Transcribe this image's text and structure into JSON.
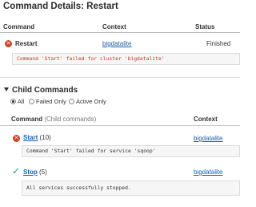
{
  "page": {
    "title": "Command Details: Restart"
  },
  "table": {
    "headers": {
      "command": "Command",
      "context": "Context",
      "status": "Status"
    },
    "row": {
      "name": "Restart",
      "context": "bigdatalite",
      "status": "Finished",
      "message": "Command 'Start' failed for cluster 'bigdatalite'"
    }
  },
  "child_commands": {
    "title": "Child Commands",
    "filters": [
      "All",
      "Failed Only",
      "Active Only"
    ],
    "selected_filter": "All",
    "headers": {
      "command": "Command",
      "command_note": "(Child commands)",
      "context": "Context"
    },
    "items": [
      {
        "name": "Start",
        "count": "(10)",
        "context": "bigdatalite",
        "message": "Command 'Start' failed for service 'sqoop'",
        "status_icon": "error-icon"
      },
      {
        "name": "Stop",
        "count": "(5)",
        "context": "bigdatalite",
        "message": "All services successfully stopped.",
        "status_icon": "check-icon"
      }
    ]
  },
  "colors": {
    "error": "#c9462b",
    "success": "#2aa198",
    "link": "#1a5fa8"
  }
}
